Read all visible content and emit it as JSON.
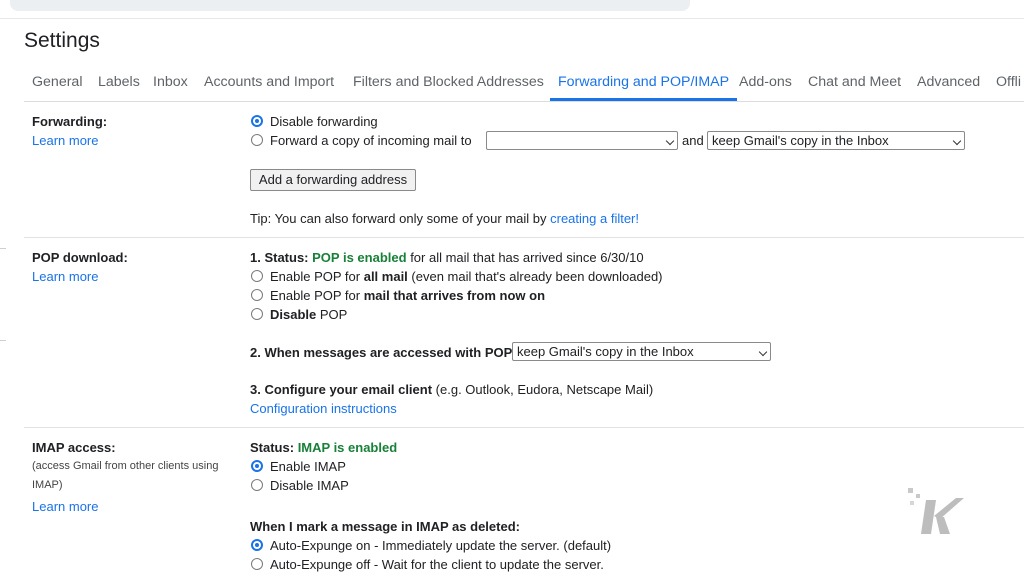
{
  "page": {
    "title": "Settings"
  },
  "tabs": [
    {
      "label": "General"
    },
    {
      "label": "Labels"
    },
    {
      "label": "Inbox"
    },
    {
      "label": "Accounts and Import"
    },
    {
      "label": "Filters and Blocked Addresses"
    },
    {
      "label": "Forwarding and POP/IMAP",
      "active": true
    },
    {
      "label": "Add-ons"
    },
    {
      "label": "Chat and Meet"
    },
    {
      "label": "Advanced"
    },
    {
      "label": "Offli"
    }
  ],
  "forwarding": {
    "label": "Forwarding:",
    "learn_more": "Learn more",
    "option_disable": "Disable forwarding",
    "option_forward": "Forward a copy of incoming mail to",
    "forward_address": "",
    "and_text": "and",
    "keep_option": "keep Gmail's copy in the Inbox",
    "add_button": "Add a forwarding address",
    "tip_text": "Tip: You can also forward only some of your mail by",
    "tip_link": "creating a filter!"
  },
  "pop": {
    "label": "POP download:",
    "learn_more": "Learn more",
    "status_prefix": "1. Status:",
    "status_value": "POP is enabled",
    "status_suffix": "for all mail that has arrived since 6/30/10",
    "opt1_a": "Enable POP for",
    "opt1_b": "all mail",
    "opt1_c": "(even mail that's already been downloaded)",
    "opt2_a": "Enable POP for",
    "opt2_b": "mail that arrives from now on",
    "opt3_a": "Disable",
    "opt3_b": "POP",
    "step2": "2. When messages are accessed with POP",
    "step2_select": "keep Gmail's copy in the Inbox",
    "step3": "3. Configure your email client",
    "step3_note": "(e.g. Outlook, Eudora, Netscape Mail)",
    "config_link": "Configuration instructions"
  },
  "imap": {
    "label": "IMAP access:",
    "note1": "(access Gmail from other clients using",
    "note2": "IMAP)",
    "learn_more": "Learn more",
    "status_prefix": "Status:",
    "status_value": "IMAP is enabled",
    "opt_enable": "Enable IMAP",
    "opt_disable": "Disable IMAP",
    "deleted_heading": "When I mark a message in IMAP as deleted:",
    "expunge_on": "Auto-Expunge on - Immediately update the server. (default)",
    "expunge_off": "Auto-Expunge off - Wait for the client to update the server."
  },
  "colors": {
    "accent": "#1a73e8",
    "status_green": "#188038",
    "watermark": "#bdbdbd"
  },
  "icons": {
    "watermark": "k-logo-icon",
    "dropdown": "chevron-down-icon"
  }
}
